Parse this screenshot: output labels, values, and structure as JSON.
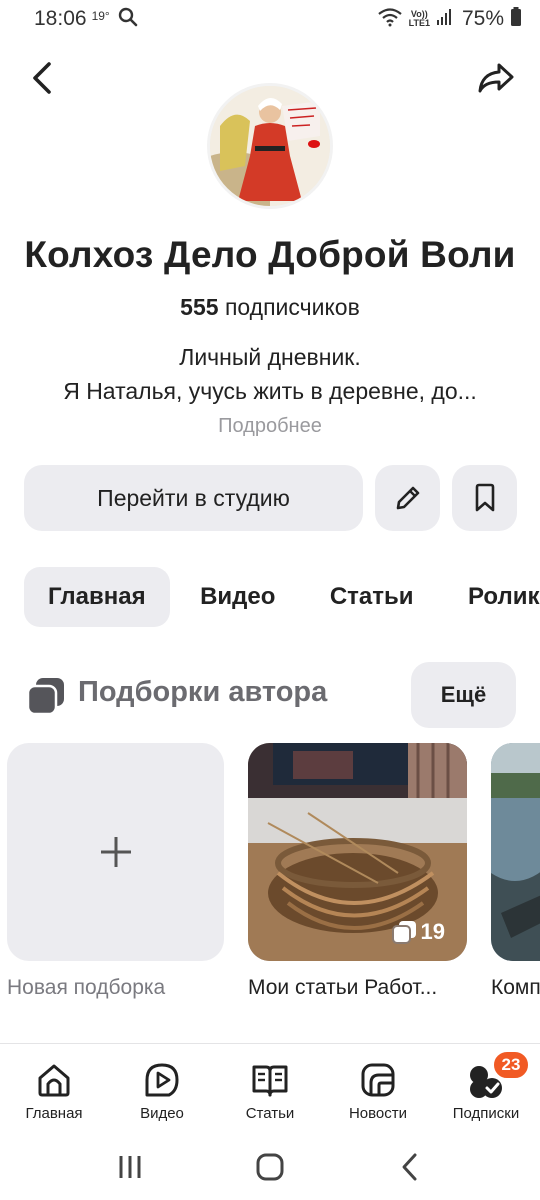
{
  "status_bar": {
    "time": "18:06",
    "temperature": "19°",
    "network_top": "Vo))",
    "network_bottom": "LTE1",
    "battery": "75%"
  },
  "profile": {
    "channel_name": "Колхоз Дело Доброй Воли",
    "subscribers_count": "555",
    "subscribers_label": "подписчиков",
    "description_line1": "Личный дневник.",
    "description_line2": "Я Наталья, учусь жить в деревне, до...",
    "more_link": "Подробнее"
  },
  "actions": {
    "studio_button": "Перейти в студию"
  },
  "tabs": [
    {
      "label": "Главная",
      "active": true
    },
    {
      "label": "Видео",
      "active": false
    },
    {
      "label": "Статьи",
      "active": false
    },
    {
      "label": "Ролики",
      "active": false
    }
  ],
  "collections": {
    "title": "Подборки автора",
    "more_button": "Ещё",
    "new_label": "Новая подборка",
    "cards": [
      {
        "label": "Мои статьи Работ...",
        "count": "19"
      },
      {
        "label": "Комп"
      }
    ]
  },
  "bottom_nav": [
    {
      "label": "Главная",
      "icon": "home-icon"
    },
    {
      "label": "Видео",
      "icon": "video-icon"
    },
    {
      "label": "Статьи",
      "icon": "articles-icon"
    },
    {
      "label": "Новости",
      "icon": "news-icon"
    },
    {
      "label": "Подписки",
      "icon": "subscriptions-icon",
      "badge": "23"
    }
  ],
  "colors": {
    "accent_badge": "#f15a24",
    "button_bg": "#ececf0"
  }
}
